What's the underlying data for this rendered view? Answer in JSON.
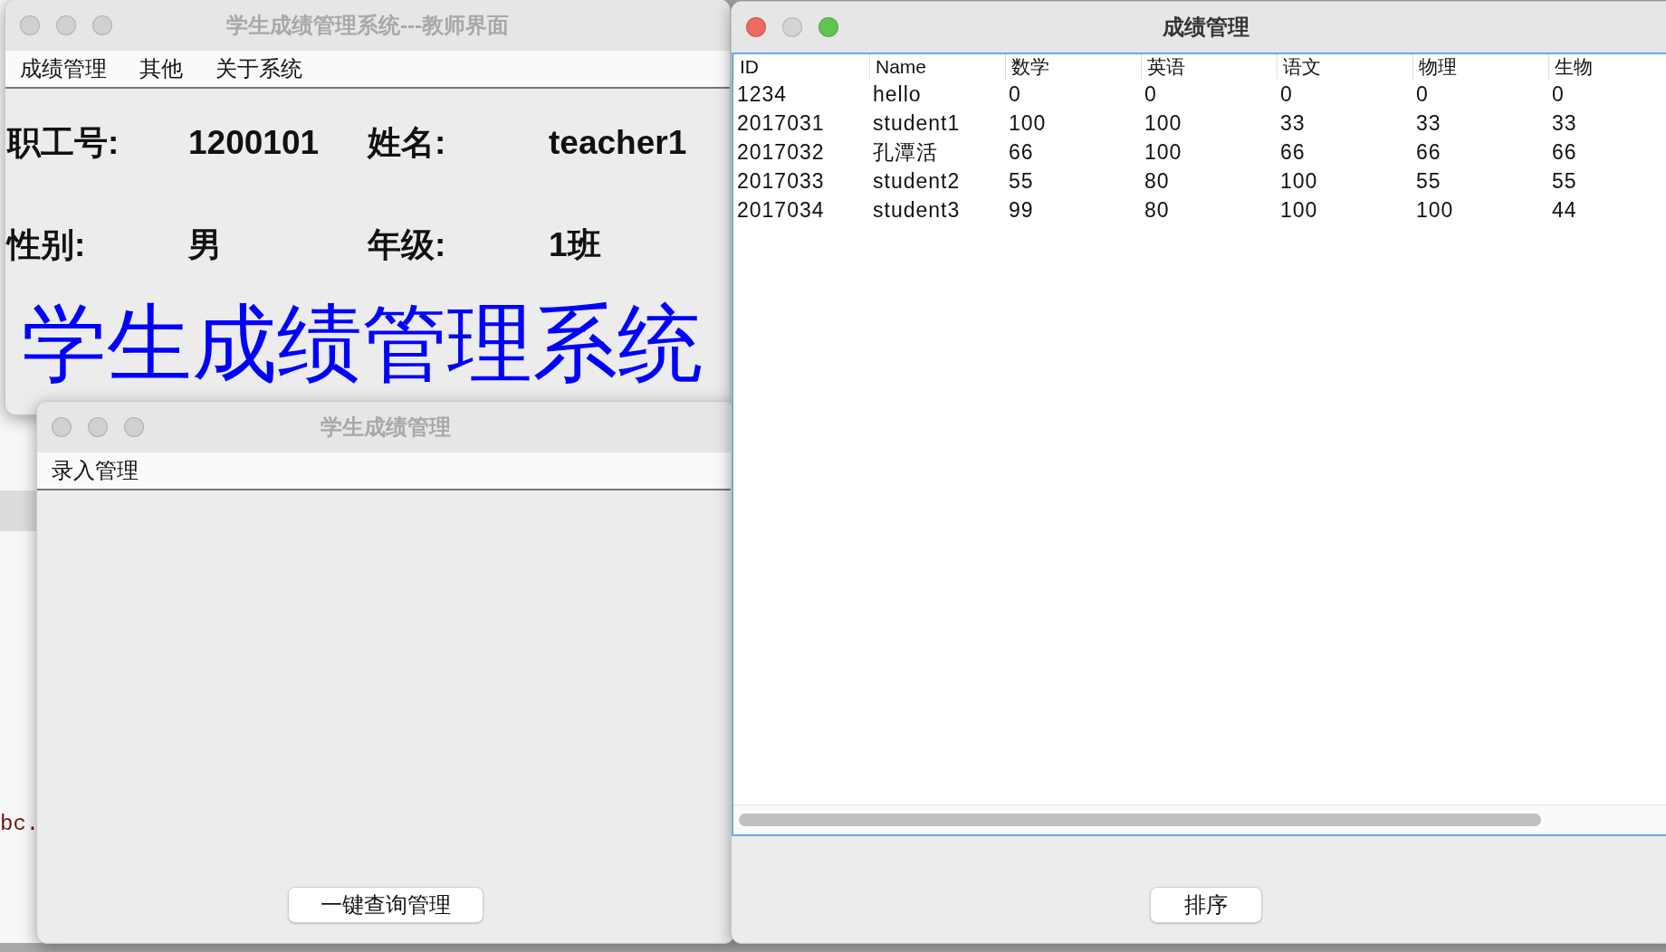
{
  "background_editor": {
    "text": "bc."
  },
  "teacher_window": {
    "title": "学生成绩管理系统---教师界面",
    "active": false,
    "menu": [
      "成绩管理",
      "其他",
      "关于系统"
    ],
    "fields": [
      {
        "label": "职工号:",
        "value": "1200101"
      },
      {
        "label": "姓名:",
        "value": "teacher1"
      },
      {
        "label": "性别:",
        "value": "男"
      },
      {
        "label": "年级:",
        "value": "1班"
      }
    ],
    "banner": "学生成绩管理系统"
  },
  "entry_window": {
    "title": "学生成绩管理",
    "active": false,
    "menu": [
      "录入管理"
    ],
    "button": "一键查询管理"
  },
  "grades_window": {
    "title": "成绩管理",
    "active": true,
    "table": {
      "columns": [
        "ID",
        "Name",
        "数学",
        "英语",
        "语文",
        "物理",
        "生物"
      ],
      "rows": [
        [
          "1234",
          "hello",
          "0",
          "0",
          "0",
          "0",
          "0"
        ],
        [
          "2017031",
          "student1",
          "100",
          "100",
          "33",
          "33",
          "33"
        ],
        [
          "2017032",
          "孔潭活",
          "66",
          "100",
          "66",
          "66",
          "66"
        ],
        [
          "2017033",
          "student2",
          "55",
          "80",
          "100",
          "55",
          "55"
        ],
        [
          "2017034",
          "student3",
          "99",
          "80",
          "100",
          "100",
          "44"
        ]
      ]
    },
    "button": "排序"
  }
}
